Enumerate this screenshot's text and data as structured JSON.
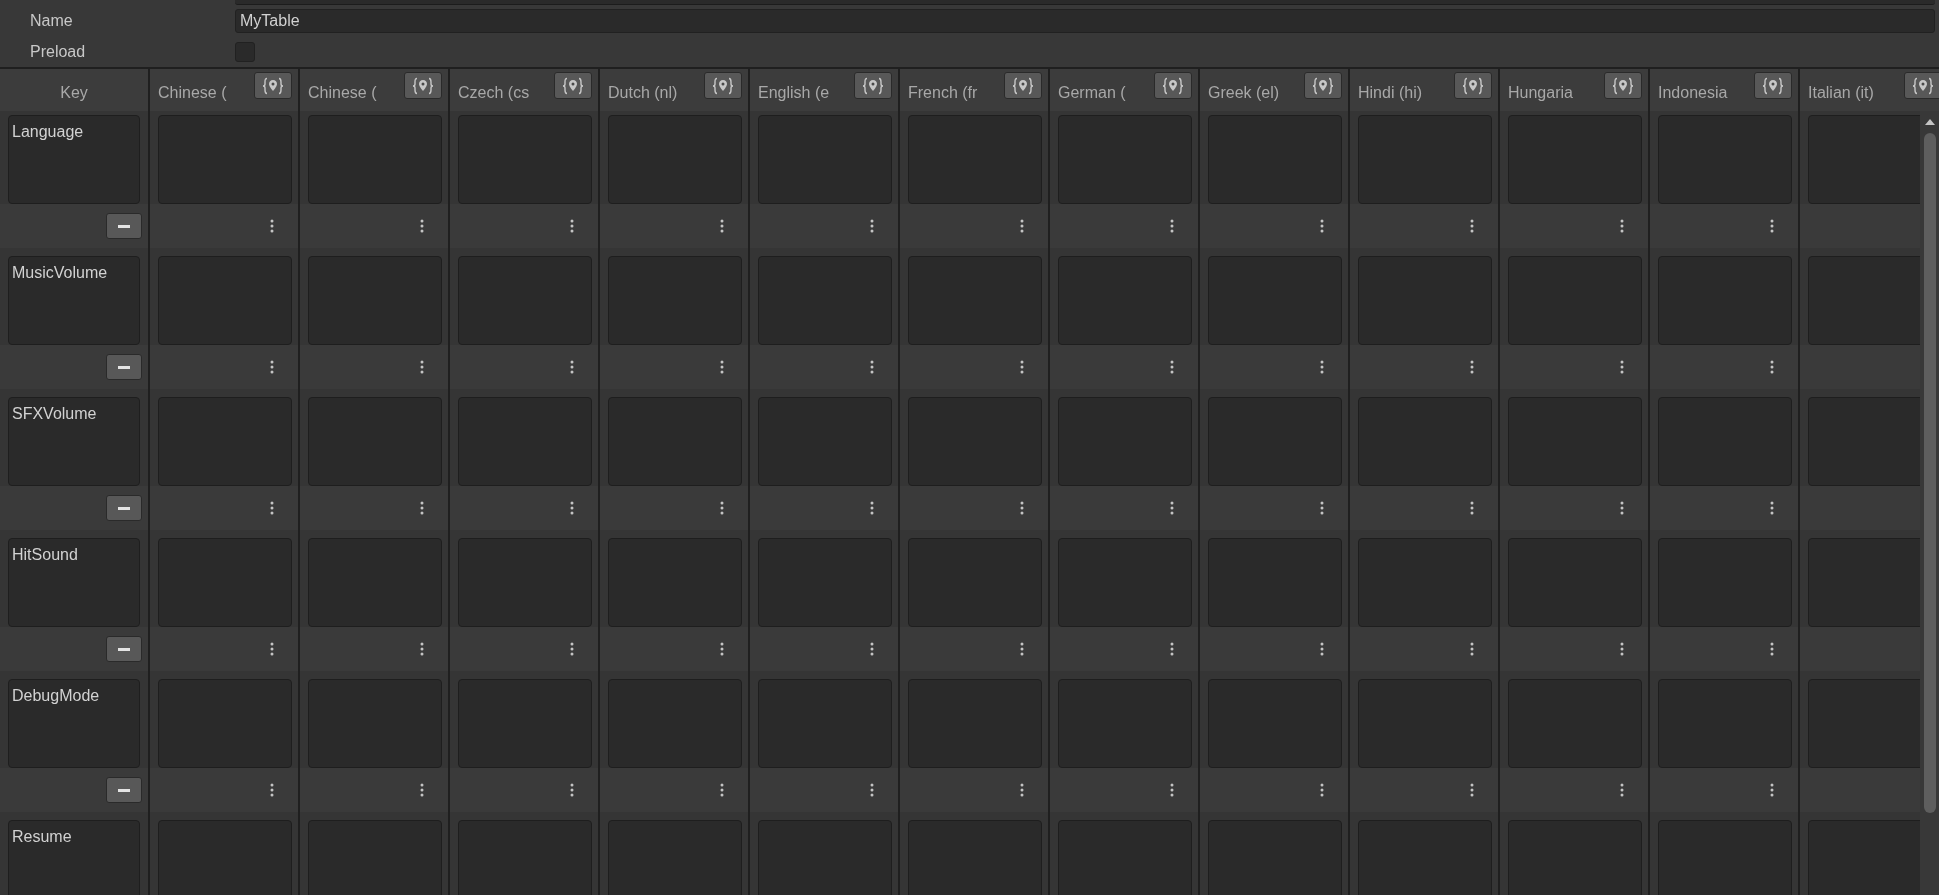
{
  "fields": {
    "name": {
      "label": "Name",
      "value": "MyTable"
    },
    "preload": {
      "label": "Preload",
      "checked": false
    }
  },
  "table": {
    "key_header": "Key",
    "columns": [
      {
        "label": "Chinese ("
      },
      {
        "label": "Chinese ("
      },
      {
        "label": "Czech (cs"
      },
      {
        "label": "Dutch (nl)"
      },
      {
        "label": "English (e"
      },
      {
        "label": "French (fr"
      },
      {
        "label": "German ("
      },
      {
        "label": "Greek (el)"
      },
      {
        "label": "Hindi (hi)"
      },
      {
        "label": "Hungaria"
      },
      {
        "label": "Indonesia"
      },
      {
        "label": "Italian (it)"
      }
    ],
    "rows": [
      {
        "key": "Language"
      },
      {
        "key": "MusicVolume"
      },
      {
        "key": "SFXVolume"
      },
      {
        "key": "HitSound"
      },
      {
        "key": "DebugMode"
      },
      {
        "key": "Resume"
      }
    ]
  }
}
